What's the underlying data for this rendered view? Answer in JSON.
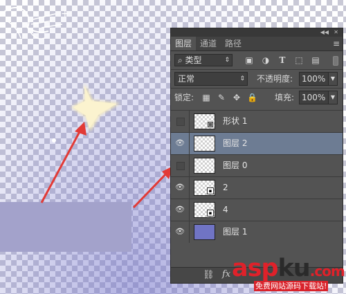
{
  "panel": {
    "tabs": [
      "图层",
      "通道",
      "路径"
    ],
    "filter": {
      "label": "类型",
      "icons": [
        "image-icon",
        "adjustment-icon",
        "text-icon",
        "shape-icon",
        "smart-object-icon"
      ]
    },
    "blend_mode": "正常",
    "opacity_label": "不透明度:",
    "opacity_value": "100%",
    "lock_label": "锁定:",
    "fill_label": "填充:",
    "fill_value": "100%",
    "layers": [
      {
        "name": "形状 1",
        "visible": false,
        "selected": false,
        "thumb": "shape"
      },
      {
        "name": "图层 2",
        "visible": true,
        "selected": true,
        "thumb": "transparent"
      },
      {
        "name": "图层 0",
        "visible": false,
        "selected": false,
        "thumb": "transparent"
      },
      {
        "name": "2",
        "visible": true,
        "selected": false,
        "thumb": "smart"
      },
      {
        "name": "4",
        "visible": true,
        "selected": false,
        "thumb": "smart"
      },
      {
        "name": "图层 1",
        "visible": true,
        "selected": false,
        "thumb": "fill"
      }
    ],
    "bottom": {
      "fx_label": "fx"
    }
  },
  "watermark": {
    "main_a": "asp",
    "main_b": "ku",
    "main_c": ".com",
    "sub": "免费网站源码下载站!"
  },
  "colors": {
    "selected_layer": "#6d7c93",
    "panel_bg": "#535353",
    "arrow": "#e23a36",
    "star": "#fbf3cf",
    "purple_rect": "#a3a2cb"
  }
}
